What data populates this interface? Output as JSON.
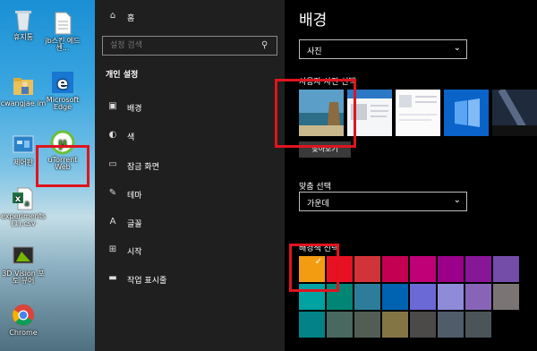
{
  "desktop": {
    "icons": [
      {
        "label": "휴지통",
        "icon": "recycle-bin-icon"
      },
      {
        "label": "jb스킨 에드센...",
        "icon": "file-icon"
      },
      {
        "label": "cwangjae im",
        "icon": "user-folder-icon"
      },
      {
        "label": "Microsoft Edge",
        "icon": "edge-icon"
      },
      {
        "label": "제어판",
        "icon": "control-panel-icon"
      },
      {
        "label": "uTorrent Web",
        "icon": "utorrent-icon"
      },
      {
        "label": "experiments (1).csv",
        "icon": "excel-icon"
      },
      {
        "label": "3D Vision 포토 뷰어",
        "icon": "3d-vision-icon"
      },
      {
        "label": "Chrome",
        "icon": "chrome-icon"
      }
    ]
  },
  "nav": {
    "home_label": "홈",
    "search_placeholder": "설정 검색",
    "section_title": "개인 설정",
    "items": [
      {
        "label": "배경",
        "icon": "picture-icon"
      },
      {
        "label": "색",
        "icon": "palette-icon"
      },
      {
        "label": "잠금 화면",
        "icon": "lock-screen-icon"
      },
      {
        "label": "테마",
        "icon": "theme-icon"
      },
      {
        "label": "글꼴",
        "icon": "font-icon"
      },
      {
        "label": "시작",
        "icon": "start-icon"
      },
      {
        "label": "작업 표시줄",
        "icon": "taskbar-icon"
      }
    ]
  },
  "main": {
    "title": "배경",
    "background_value": "사진",
    "choose_picture_label": "사용자 사진 선택",
    "browse_label": "찾아보기",
    "fit_label": "맞춤 선택",
    "fit_value": "가운데",
    "color_label": "배경색 선택",
    "colors": [
      "#f39c12",
      "#e81123",
      "#d13438",
      "#c30052",
      "#bf0077",
      "#9a0089",
      "#881798",
      "#744da9",
      "#00a2a2",
      "#018574",
      "#2d7d9a",
      "#0063b1",
      "#6b69d6",
      "#8e8cd8",
      "#8764b8",
      "#7a7574",
      "#038387",
      "#486860",
      "#525e54",
      "#847545",
      "#4c4a48",
      "#515c6b",
      "#4a5459",
      "#000000"
    ]
  }
}
